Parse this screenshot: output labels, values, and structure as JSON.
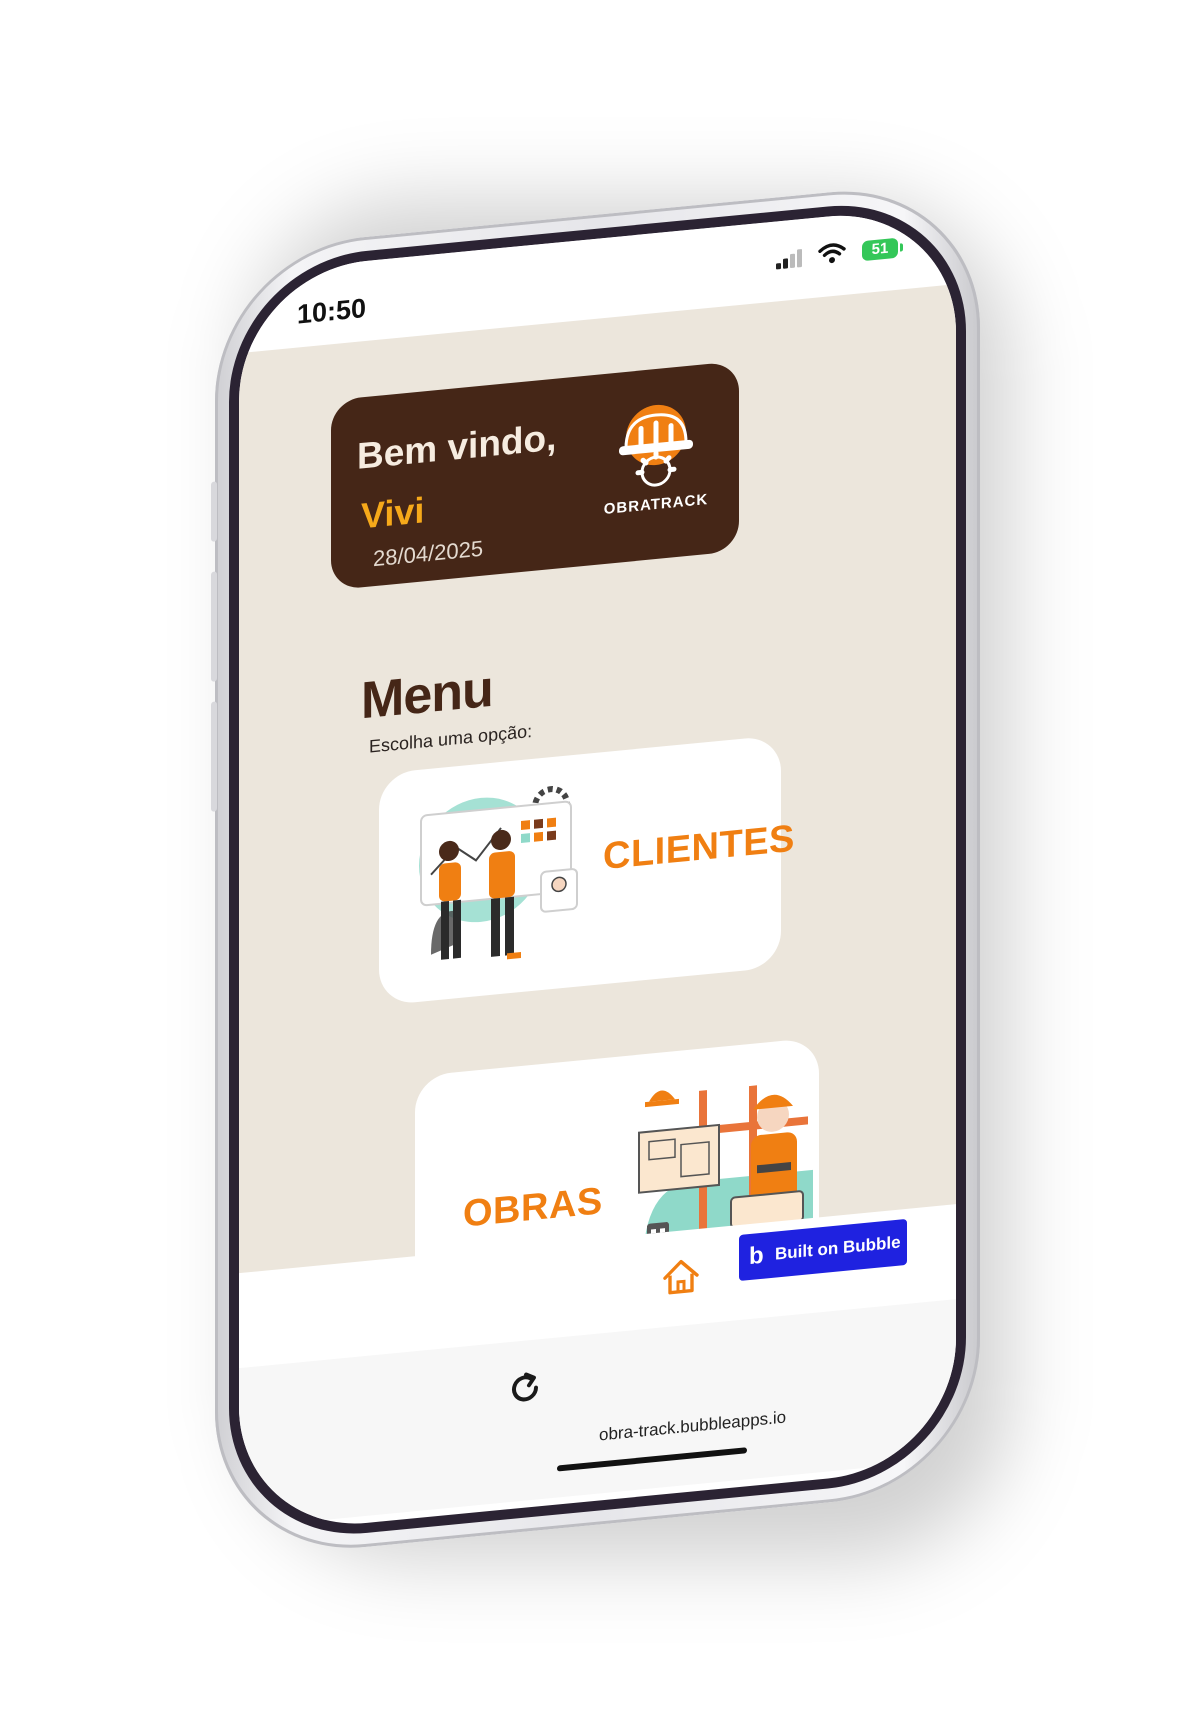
{
  "status_bar": {
    "time": "10:50",
    "battery": "51"
  },
  "welcome": {
    "greeting": "Bem vindo,",
    "user_name": "Vivi",
    "date": "28/04/2025",
    "logo_text": "OBRATRACK"
  },
  "menu": {
    "title": "Menu",
    "subtitle": "Escolha uma opção:",
    "options": [
      {
        "label": "CLIENTES",
        "illustration": "clients-meeting-illustration"
      },
      {
        "label": "OBRAS",
        "illustration": "construction-worker-illustration"
      }
    ]
  },
  "badge": {
    "label": "Built on Bubble",
    "logo": "b"
  },
  "navigation": {
    "home_icon": "home-icon"
  },
  "browser": {
    "url": "obra-track.bubbleapps.io",
    "reload_icon": "reload-icon"
  },
  "colors": {
    "background": "#ece6dc",
    "card_dark": "#452617",
    "accent_orange": "#f07f12",
    "name_yellow": "#f6a91a",
    "teal": "#8fd9c9",
    "bubble_blue": "#1f22e0"
  }
}
